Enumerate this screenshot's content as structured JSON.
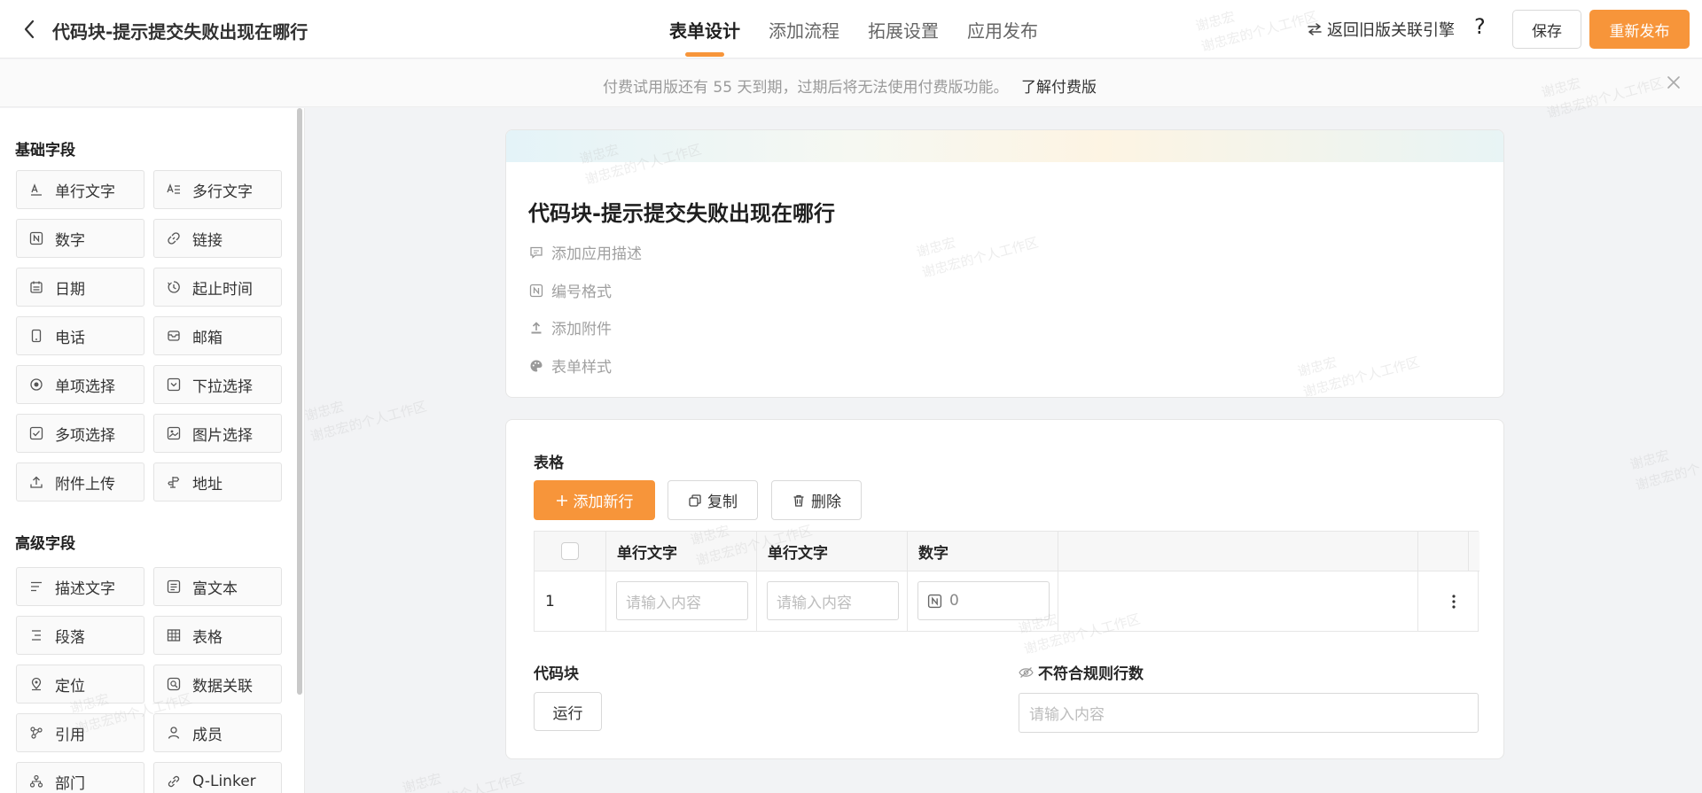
{
  "header": {
    "title": "代码块-提示提交失败出现在哪行",
    "tabs": [
      {
        "label": "表单设计"
      },
      {
        "label": "添加流程"
      },
      {
        "label": "拓展设置"
      },
      {
        "label": "应用发布"
      }
    ],
    "legacy_label": "返回旧版关联引擎",
    "help_label": "?",
    "save_label": "保存",
    "publish_label": "重新发布",
    "accent_color": "#f7953a"
  },
  "notice": {
    "text": "付费试用版还有 55 天到期，过期后将无法使用付费版功能。",
    "link": "了解付费版"
  },
  "sidebar": {
    "basic_title": "基础字段",
    "basic_fields": [
      {
        "label": "单行文字",
        "icon": "text-a-icon"
      },
      {
        "label": "多行文字",
        "icon": "multiline-text-icon"
      },
      {
        "label": "数字",
        "icon": "number-n-icon"
      },
      {
        "label": "链接",
        "icon": "link-icon"
      },
      {
        "label": "日期",
        "icon": "calendar-icon"
      },
      {
        "label": "起止时间",
        "icon": "time-range-icon"
      },
      {
        "label": "电话",
        "icon": "phone-icon"
      },
      {
        "label": "邮箱",
        "icon": "mailbox-icon"
      },
      {
        "label": "单项选择",
        "icon": "radio-icon"
      },
      {
        "label": "下拉选择",
        "icon": "dropdown-check-icon"
      },
      {
        "label": "多项选择",
        "icon": "checkbox-icon"
      },
      {
        "label": "图片选择",
        "icon": "image-icon"
      },
      {
        "label": "附件上传",
        "icon": "upload-icon"
      },
      {
        "label": "地址",
        "icon": "address-icon"
      }
    ],
    "advanced_title": "高级字段",
    "advanced_fields": [
      {
        "label": "描述文字",
        "icon": "description-icon"
      },
      {
        "label": "富文本",
        "icon": "rich-text-icon"
      },
      {
        "label": "段落",
        "icon": "paragraph-icon"
      },
      {
        "label": "表格",
        "icon": "table-icon"
      },
      {
        "label": "定位",
        "icon": "location-pin-icon"
      },
      {
        "label": "数据关联",
        "icon": "data-link-icon"
      },
      {
        "label": "引用",
        "icon": "reference-icon"
      },
      {
        "label": "成员",
        "icon": "member-icon"
      },
      {
        "label": "部门",
        "icon": "department-icon"
      },
      {
        "label": "Q-Linker",
        "icon": "q-linker-icon"
      }
    ]
  },
  "form": {
    "title": "代码块-提示提交失败出现在哪行",
    "meta": [
      {
        "label": "添加应用描述",
        "icon": "comment-icon"
      },
      {
        "label": "编号格式",
        "icon": "number-n-icon"
      },
      {
        "label": "添加附件",
        "icon": "upload-icon"
      },
      {
        "label": "表单样式",
        "icon": "palette-icon"
      }
    ]
  },
  "table": {
    "label": "表格",
    "add_row": "添加新行",
    "copy": "复制",
    "delete": "删除",
    "columns": [
      "单行文字",
      "单行文字",
      "数字"
    ],
    "row_index": "1",
    "cell_placeholder": "请输入内容",
    "number_value": "0"
  },
  "code_block": {
    "label": "代码块",
    "run": "运行"
  },
  "rule": {
    "label": "不符合规则行数",
    "placeholder": "请输入内容"
  },
  "watermark": {
    "name": "谢忠宏",
    "workspace": "谢忠宏的个人工作区"
  }
}
